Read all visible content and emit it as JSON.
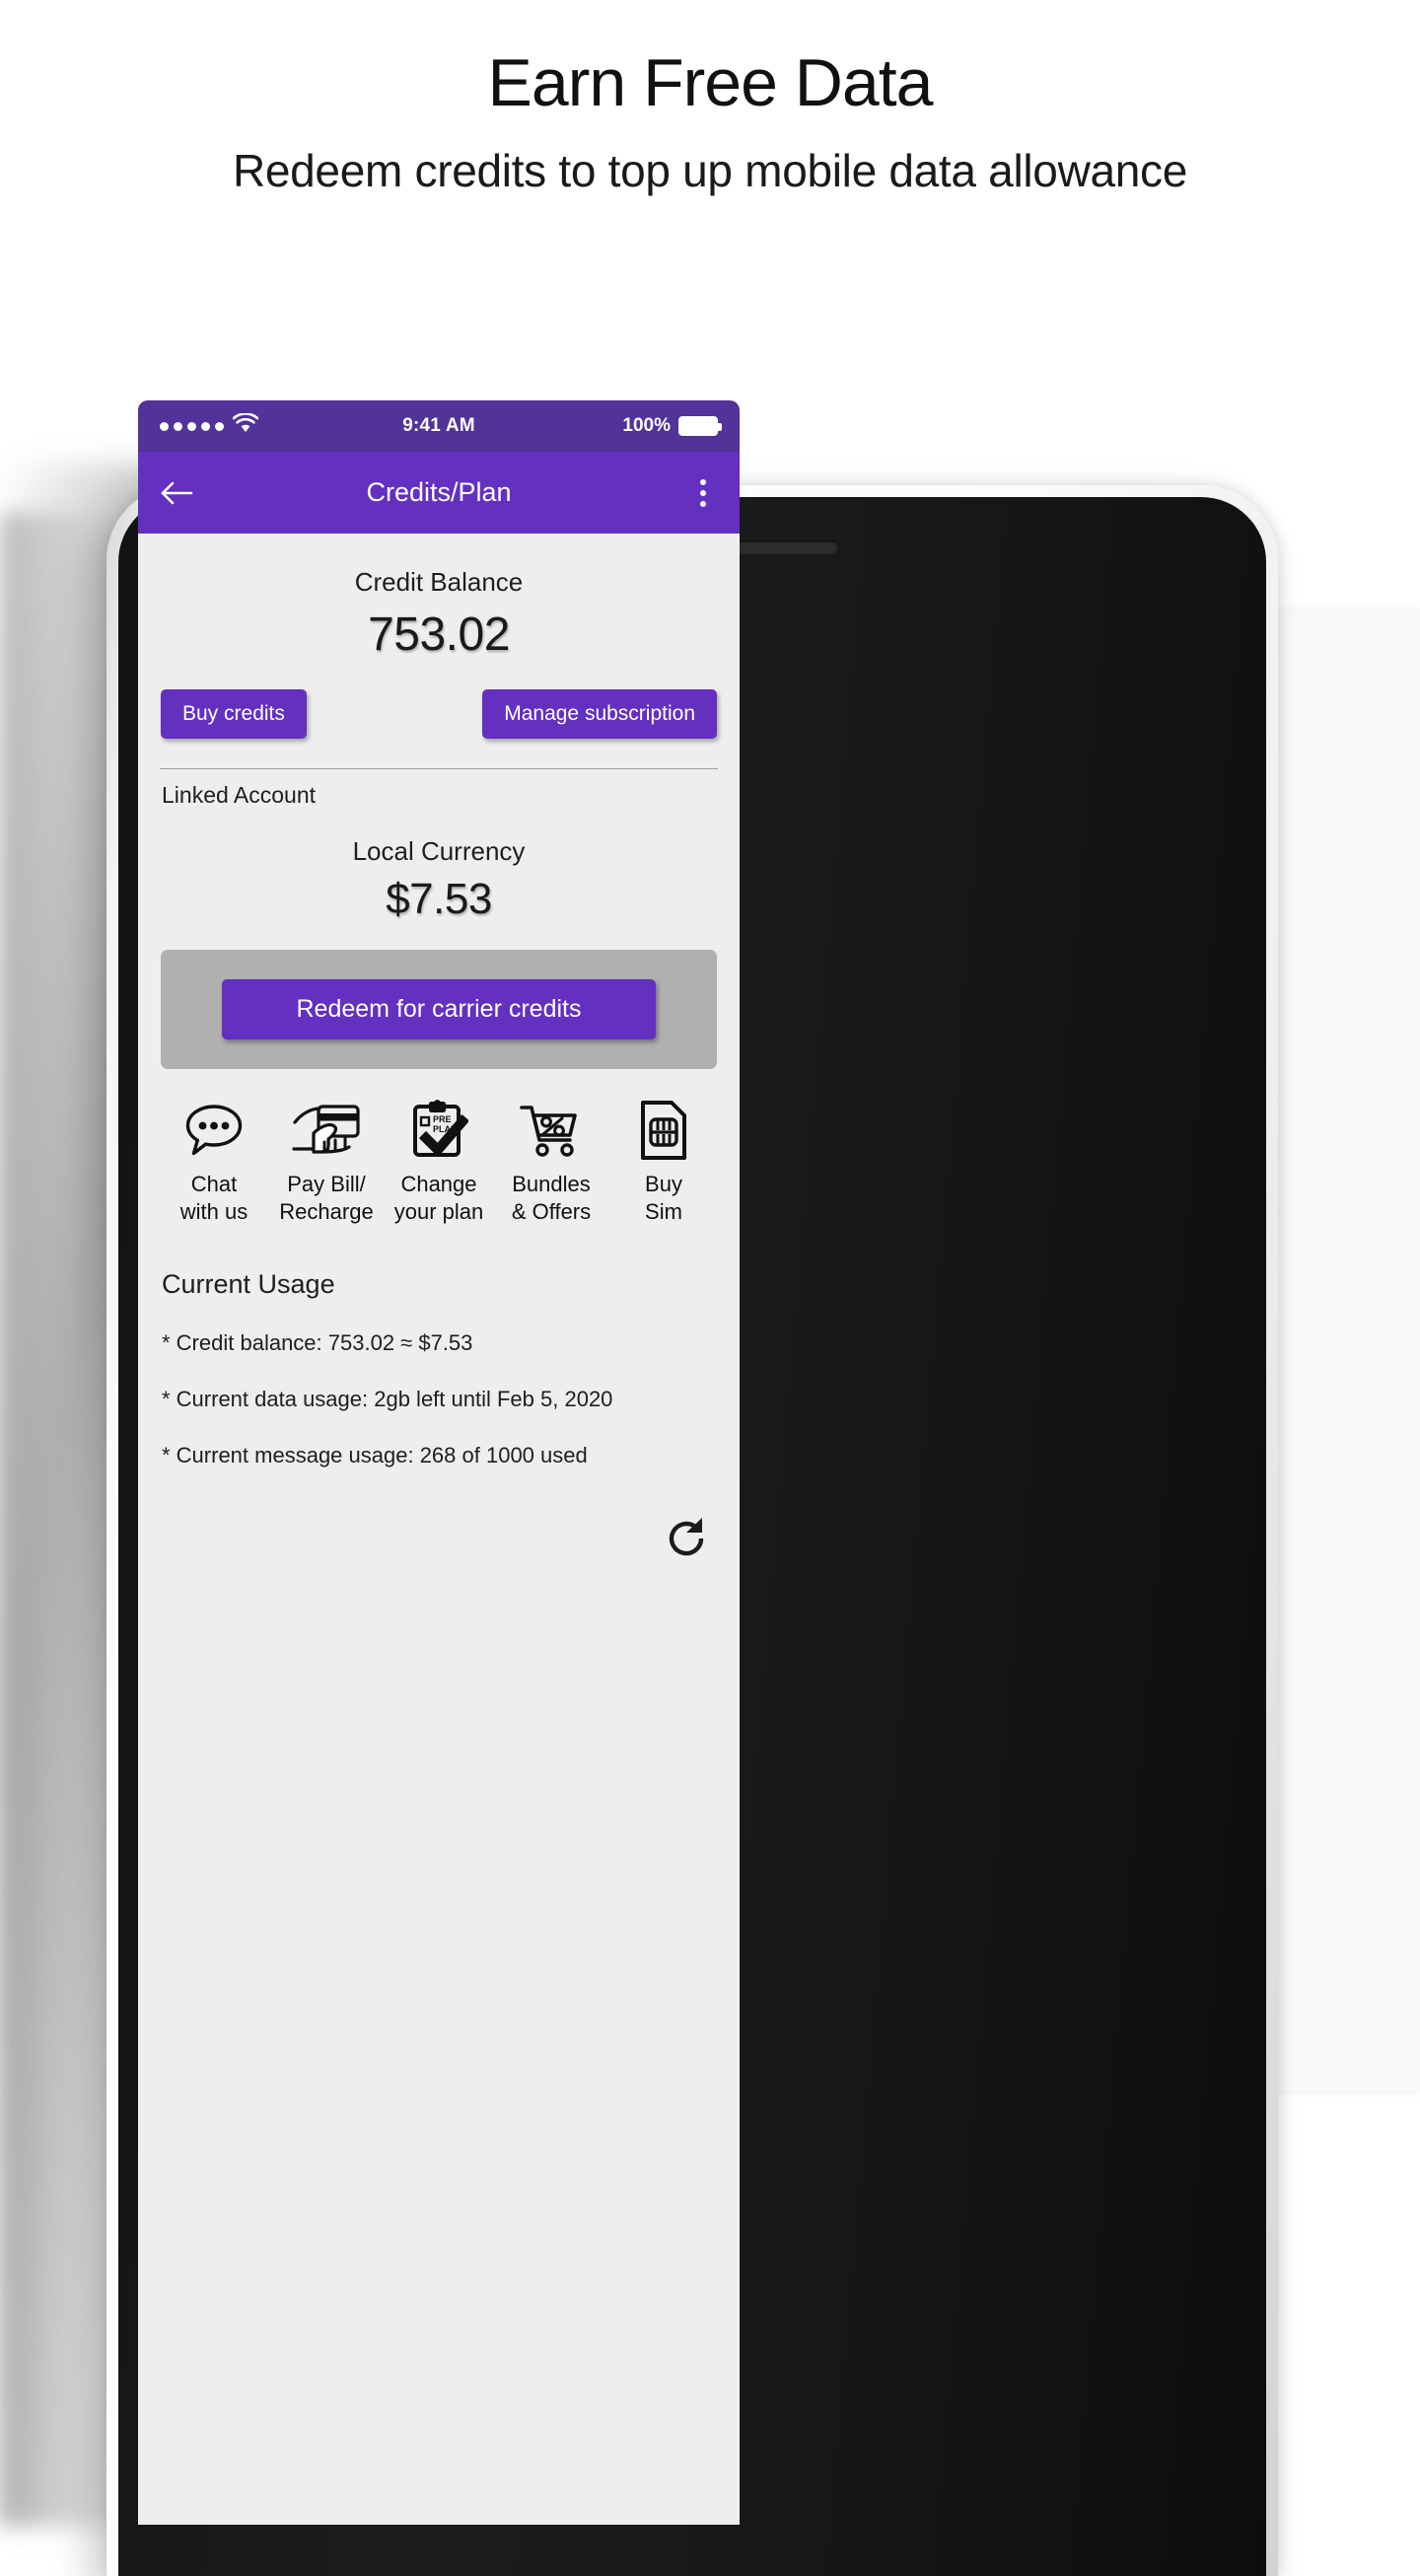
{
  "promo": {
    "title": "Earn Free Data",
    "subtitle": "Redeem credits to top up mobile data allowance"
  },
  "phone": {
    "status_bar": {
      "signal_dots": 5,
      "wifi_icon": "wifi-icon",
      "time": "9:41 AM",
      "battery_percent": "100%",
      "battery_icon": "battery-full-icon"
    },
    "app_bar": {
      "back_icon": "back-arrow-icon",
      "title": "Credits/Plan",
      "overflow_icon": "overflow-menu-icon"
    },
    "balance": {
      "label": "Credit Balance",
      "value": "753.02"
    },
    "actions": {
      "buy_credits": "Buy credits",
      "manage_subscription": "Manage subscription"
    },
    "linked_account": {
      "section_label": "Linked Account",
      "currency_label": "Local Currency",
      "currency_value": "$7.53",
      "redeem_label": "Redeem for carrier credits"
    },
    "shortcuts": [
      {
        "icon": "chat-bubble-icon",
        "label": "Chat\nwith us"
      },
      {
        "icon": "hand-credit-card-icon",
        "label": "Pay Bill/\nRecharge"
      },
      {
        "icon": "clipboard-plan-icon",
        "label": "Change\nyour plan",
        "badge_line1": "PRE",
        "badge_line2": "PLAN"
      },
      {
        "icon": "cart-percent-icon",
        "label": "Bundles\n& Offers"
      },
      {
        "icon": "sim-card-icon",
        "label": "Buy\nSim"
      }
    ],
    "usage": {
      "title": "Current Usage",
      "lines": [
        "* Credit balance: 753.02 ≈ $7.53",
        "* Current data usage: 2gb left until Feb 5, 2020",
        "* Current message usage: 268 of 1000 used"
      ]
    },
    "refresh_icon": "refresh-icon"
  },
  "colors": {
    "status_bar": "#513399",
    "app_bar": "#6430c0",
    "primary_button": "#6430c0",
    "screen_background": "#eeeeee",
    "redeem_panel": "#b0b0b0",
    "power_button": "#fa7a55"
  }
}
